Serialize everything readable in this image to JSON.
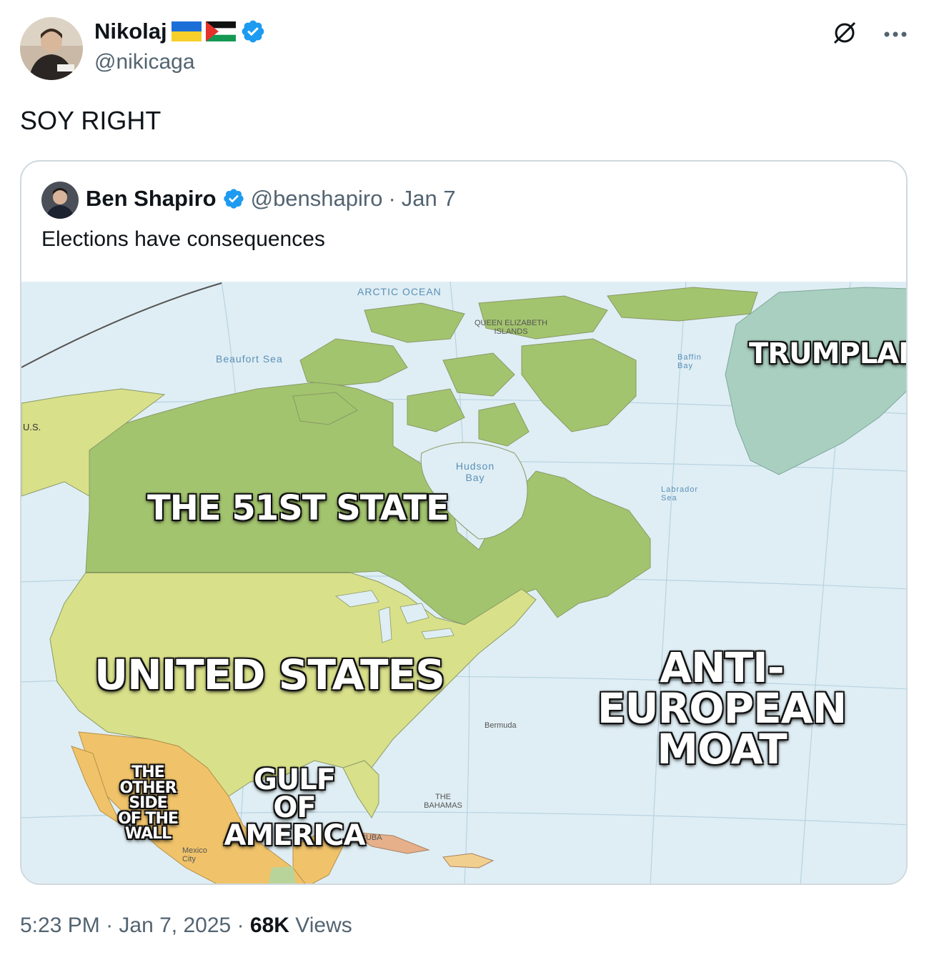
{
  "author": {
    "name": "Nikolaj",
    "handle": "@nikicaga"
  },
  "icons": {
    "top_right": [
      "grok-icon",
      "more-icon"
    ],
    "flags": [
      "ukraine-flag-icon",
      "palestine-flag-icon"
    ]
  },
  "tweet": {
    "text": "SOY RIGHT"
  },
  "quoted": {
    "name": "Ben Shapiro",
    "handle": "@benshapiro",
    "sep": "·",
    "date": "Jan 7",
    "text": "Elections have consequences",
    "map_labels": {
      "trumpland": "TRUMPLAND",
      "state51": "THE 51ST STATE",
      "us": "UNITED STATES",
      "moat_1": "ANTI-EUROPEAN",
      "moat_2": "MOAT",
      "wall_1": "THE",
      "wall_2": "OTHER SIDE",
      "wall_3": "OF THE WALL",
      "gulf_1": "GULF",
      "gulf_2": "OF AMERICA"
    },
    "map_small": {
      "arctic": "ARCTIC OCEAN",
      "beaufort": "Beaufort Sea",
      "hudson": "Hudson Bay",
      "us_label": "U.S.",
      "baffin": "Baffin Bay",
      "labrador": "Labrador Sea",
      "bahamas": "THE BAHAMAS",
      "cuba": "CUBA",
      "bermuda": "Bermuda",
      "mexico_city": "Mexico City",
      "queen": "QUEEN ELIZABETH ISLANDS"
    }
  },
  "footer": {
    "time": "5:23 PM",
    "sep": "·",
    "date": "Jan 7, 2025",
    "views_count": "68K",
    "views_label": "Views"
  },
  "colors": {
    "land_green": "#9dc46f",
    "canada_green": "#a3c46e",
    "us_yellow": "#d9e08a",
    "mexico_orange": "#f0c36a",
    "greenland": "#a9cfc0",
    "ocean": "#dfeef4",
    "verified_blue": "#1d9bf0"
  }
}
